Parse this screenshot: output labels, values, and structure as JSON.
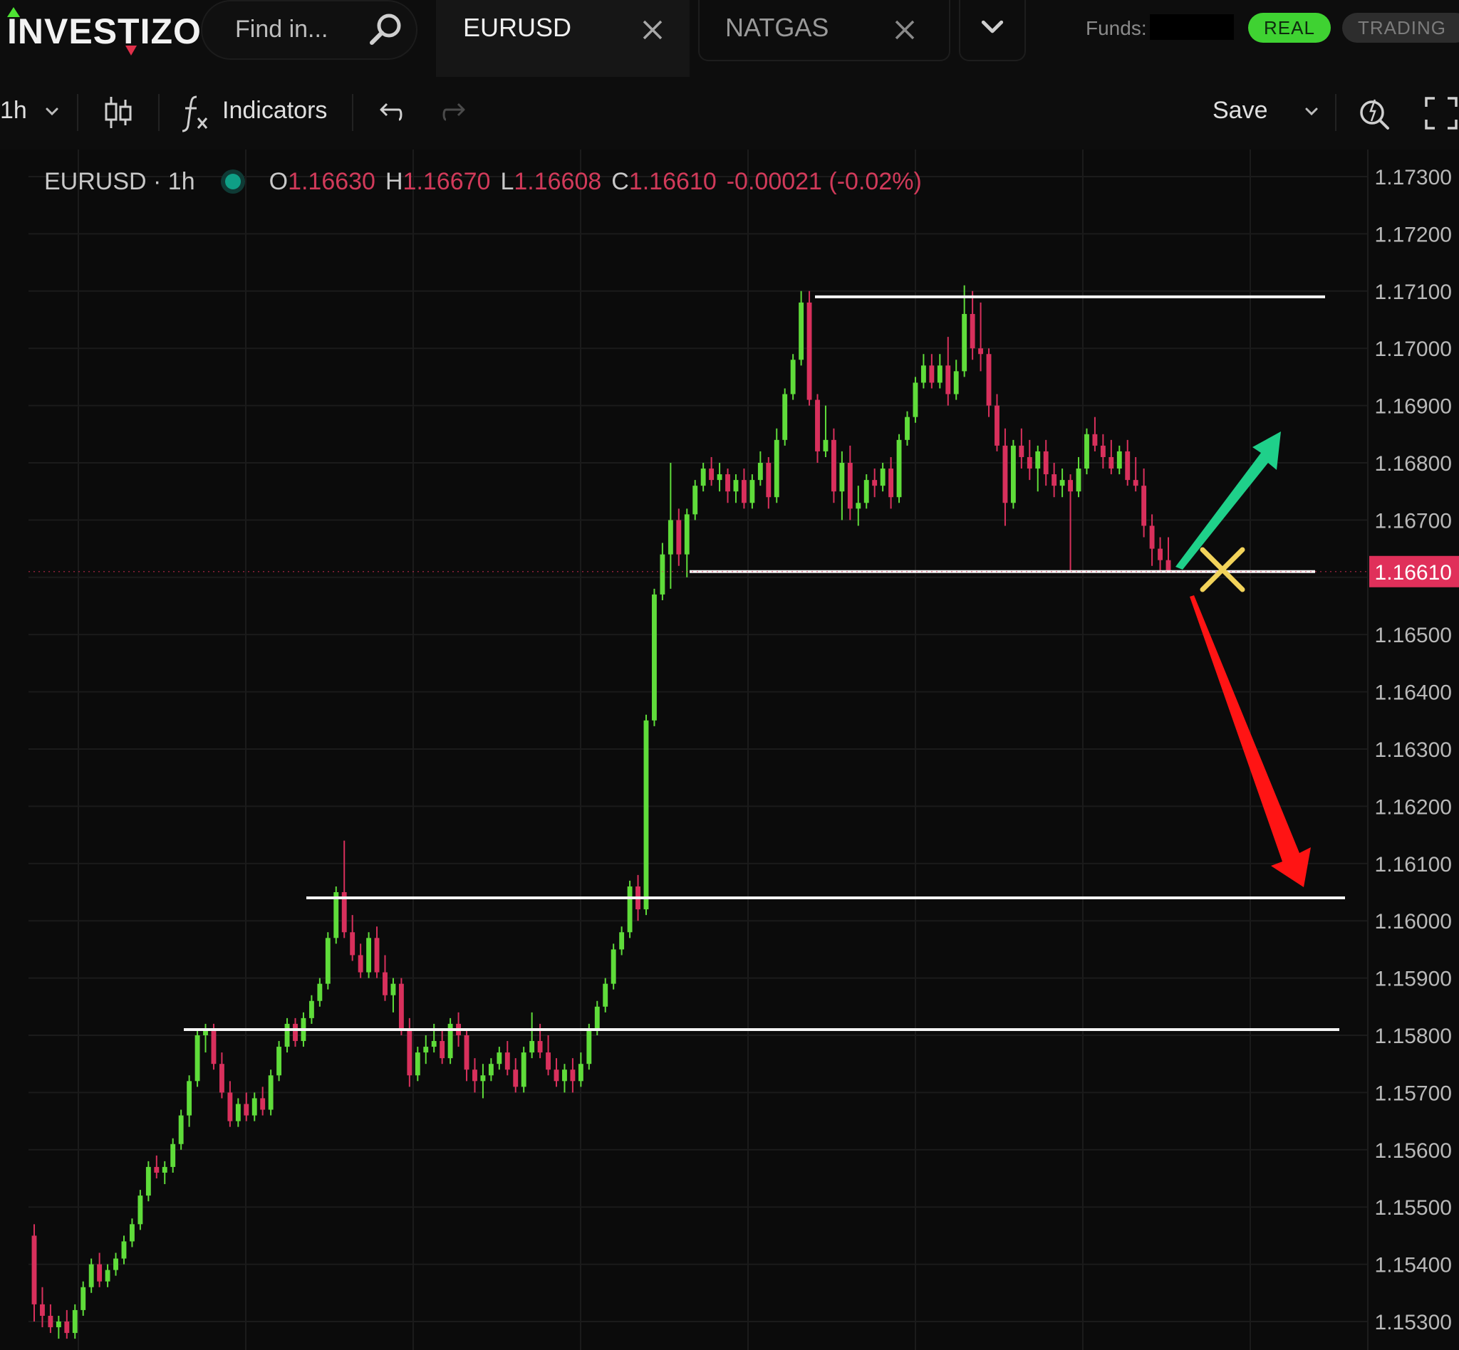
{
  "brand": {
    "logo_text": "INVESTIZO"
  },
  "search": {
    "placeholder": "Find in..."
  },
  "tabs": [
    {
      "label": "EURUSD",
      "active": true
    },
    {
      "label": "NATGAS",
      "active": false
    }
  ],
  "account": {
    "funds_label": "Funds:",
    "mode_real": "REAL",
    "mode_trading": "TRADING"
  },
  "toolbar": {
    "interval": "1h",
    "indicators_label": "Indicators",
    "save_label": "Save"
  },
  "legend": {
    "symbol": "EURUSD · 1h",
    "open_key": "O",
    "open": "1.16630",
    "high_key": "H",
    "high": "1.16670",
    "low_key": "L",
    "low": "1.16608",
    "close_key": "C",
    "close": "1.16610",
    "change": "-0.00021 (-0.02%)"
  },
  "colors": {
    "up": "#5fdc3a",
    "down": "#d8305c",
    "price_tag": "#e0305a",
    "accent_real": "#3fd232",
    "arrow_up": "#1fd08a",
    "arrow_down": "#ff1414",
    "cross_mark": "#f2d35a"
  },
  "chart_data": {
    "type": "candlestick",
    "ylim": [
      1.1527,
      1.1735
    ],
    "y_ticks": [
      "1.17300",
      "1.17200",
      "1.17100",
      "1.17000",
      "1.16900",
      "1.16800",
      "1.16700",
      "1.16500",
      "1.16400",
      "1.16300",
      "1.16200",
      "1.16100",
      "1.16000",
      "1.15900",
      "1.15800",
      "1.15700",
      "1.15600",
      "1.15500",
      "1.15400",
      "1.15300"
    ],
    "last_price": "1.16610",
    "horizontal_levels": [
      1.1709,
      1.1661,
      1.1604,
      1.1581
    ],
    "candles_approx": [
      [
        1.1545,
        1.1547,
        1.153,
        1.1533
      ],
      [
        1.1533,
        1.1536,
        1.1529,
        1.1531
      ],
      [
        1.1531,
        1.1533,
        1.1528,
        1.1529
      ],
      [
        1.1529,
        1.1531,
        1.1527,
        1.153
      ],
      [
        1.153,
        1.1532,
        1.1527,
        1.1528
      ],
      [
        1.1528,
        1.1533,
        1.1527,
        1.1532
      ],
      [
        1.1532,
        1.1537,
        1.1531,
        1.1536
      ],
      [
        1.1536,
        1.1541,
        1.1535,
        1.154
      ],
      [
        1.154,
        1.1542,
        1.1536,
        1.1537
      ],
      [
        1.1537,
        1.154,
        1.1536,
        1.1539
      ],
      [
        1.1539,
        1.1542,
        1.1538,
        1.1541
      ],
      [
        1.1541,
        1.1545,
        1.154,
        1.1544
      ],
      [
        1.1544,
        1.1548,
        1.1543,
        1.1547
      ],
      [
        1.1547,
        1.1553,
        1.1546,
        1.1552
      ],
      [
        1.1552,
        1.1558,
        1.1551,
        1.1557
      ],
      [
        1.1557,
        1.1559,
        1.1555,
        1.1556
      ],
      [
        1.1556,
        1.1558,
        1.1554,
        1.1557
      ],
      [
        1.1557,
        1.1562,
        1.1556,
        1.1561
      ],
      [
        1.1561,
        1.1567,
        1.156,
        1.1566
      ],
      [
        1.1566,
        1.1573,
        1.1564,
        1.1572
      ],
      [
        1.1572,
        1.1581,
        1.1571,
        1.158
      ],
      [
        1.158,
        1.1582,
        1.1577,
        1.1581
      ],
      [
        1.1581,
        1.1582,
        1.1574,
        1.1575
      ],
      [
        1.1575,
        1.1577,
        1.1569,
        1.157
      ],
      [
        1.157,
        1.1572,
        1.1564,
        1.1565
      ],
      [
        1.1565,
        1.1569,
        1.1564,
        1.1568
      ],
      [
        1.1568,
        1.157,
        1.1565,
        1.1566
      ],
      [
        1.1566,
        1.157,
        1.1565,
        1.1569
      ],
      [
        1.1569,
        1.1571,
        1.1566,
        1.1567
      ],
      [
        1.1567,
        1.1574,
        1.1566,
        1.1573
      ],
      [
        1.1573,
        1.1579,
        1.1572,
        1.1578
      ],
      [
        1.1578,
        1.1583,
        1.1577,
        1.1582
      ],
      [
        1.1582,
        1.1583,
        1.1578,
        1.1579
      ],
      [
        1.1579,
        1.1584,
        1.1578,
        1.1583
      ],
      [
        1.1583,
        1.1587,
        1.1582,
        1.1586
      ],
      [
        1.1586,
        1.159,
        1.1585,
        1.1589
      ],
      [
        1.1589,
        1.1598,
        1.1588,
        1.1597
      ],
      [
        1.1597,
        1.1606,
        1.1596,
        1.1605
      ],
      [
        1.1605,
        1.1614,
        1.1597,
        1.1598
      ],
      [
        1.1598,
        1.1601,
        1.1593,
        1.1594
      ],
      [
        1.1594,
        1.1596,
        1.159,
        1.1591
      ],
      [
        1.1591,
        1.1598,
        1.159,
        1.1597
      ],
      [
        1.1597,
        1.1599,
        1.159,
        1.1591
      ],
      [
        1.1591,
        1.1594,
        1.1586,
        1.1587
      ],
      [
        1.1587,
        1.159,
        1.1584,
        1.1589
      ],
      [
        1.1589,
        1.159,
        1.158,
        1.1581
      ],
      [
        1.1581,
        1.1583,
        1.1571,
        1.1573
      ],
      [
        1.1573,
        1.1578,
        1.1572,
        1.1577
      ],
      [
        1.1577,
        1.158,
        1.1575,
        1.1578
      ],
      [
        1.1578,
        1.1582,
        1.1577,
        1.1579
      ],
      [
        1.1579,
        1.1581,
        1.1575,
        1.1576
      ],
      [
        1.1576,
        1.1583,
        1.1575,
        1.1582
      ],
      [
        1.1582,
        1.1584,
        1.1578,
        1.158
      ],
      [
        1.158,
        1.1581,
        1.1572,
        1.1574
      ],
      [
        1.1574,
        1.1576,
        1.157,
        1.1572
      ],
      [
        1.1572,
        1.1575,
        1.1569,
        1.1573
      ],
      [
        1.1573,
        1.1576,
        1.1572,
        1.1575
      ],
      [
        1.1575,
        1.1578,
        1.1574,
        1.1577
      ],
      [
        1.1577,
        1.1579,
        1.1573,
        1.1574
      ],
      [
        1.1574,
        1.1576,
        1.157,
        1.1571
      ],
      [
        1.1571,
        1.1578,
        1.157,
        1.1577
      ],
      [
        1.1577,
        1.1584,
        1.1576,
        1.1579
      ],
      [
        1.1579,
        1.1582,
        1.1576,
        1.1577
      ],
      [
        1.1577,
        1.158,
        1.1573,
        1.1574
      ],
      [
        1.1574,
        1.1576,
        1.1571,
        1.1572
      ],
      [
        1.1572,
        1.1575,
        1.157,
        1.1574
      ],
      [
        1.1574,
        1.1576,
        1.157,
        1.1572
      ],
      [
        1.1572,
        1.1577,
        1.1571,
        1.1575
      ],
      [
        1.1575,
        1.1582,
        1.1574,
        1.1581
      ],
      [
        1.1581,
        1.1586,
        1.158,
        1.1585
      ],
      [
        1.1585,
        1.159,
        1.1584,
        1.1589
      ],
      [
        1.1589,
        1.1596,
        1.1588,
        1.1595
      ],
      [
        1.1595,
        1.1599,
        1.1594,
        1.1598
      ],
      [
        1.1598,
        1.1607,
        1.1597,
        1.1606
      ],
      [
        1.1606,
        1.1608,
        1.16,
        1.1602
      ],
      [
        1.1602,
        1.1636,
        1.1601,
        1.1635
      ],
      [
        1.1635,
        1.1658,
        1.1634,
        1.1657
      ],
      [
        1.1657,
        1.1666,
        1.1656,
        1.1664
      ],
      [
        1.1664,
        1.168,
        1.1658,
        1.167
      ],
      [
        1.167,
        1.1672,
        1.1662,
        1.1664
      ],
      [
        1.1664,
        1.1672,
        1.166,
        1.1671
      ],
      [
        1.1671,
        1.1677,
        1.167,
        1.1676
      ],
      [
        1.1676,
        1.168,
        1.1675,
        1.1679
      ],
      [
        1.1679,
        1.1681,
        1.1676,
        1.1677
      ],
      [
        1.1677,
        1.168,
        1.1675,
        1.1678
      ],
      [
        1.1678,
        1.1679,
        1.1673,
        1.1675
      ],
      [
        1.1675,
        1.1678,
        1.1673,
        1.1677
      ],
      [
        1.1677,
        1.1679,
        1.1672,
        1.1673
      ],
      [
        1.1673,
        1.1678,
        1.1672,
        1.1677
      ],
      [
        1.1677,
        1.1682,
        1.1676,
        1.168
      ],
      [
        1.168,
        1.1681,
        1.1672,
        1.1674
      ],
      [
        1.1674,
        1.1686,
        1.1673,
        1.1684
      ],
      [
        1.1684,
        1.1693,
        1.1683,
        1.1692
      ],
      [
        1.1692,
        1.1699,
        1.1691,
        1.1698
      ],
      [
        1.1698,
        1.171,
        1.1697,
        1.1708
      ],
      [
        1.1708,
        1.171,
        1.169,
        1.1691
      ],
      [
        1.1691,
        1.1692,
        1.168,
        1.1682
      ],
      [
        1.1682,
        1.169,
        1.1681,
        1.1684
      ],
      [
        1.1684,
        1.1686,
        1.1673,
        1.1675
      ],
      [
        1.1675,
        1.1682,
        1.167,
        1.168
      ],
      [
        1.168,
        1.1683,
        1.167,
        1.1672
      ],
      [
        1.1672,
        1.1676,
        1.1669,
        1.1673
      ],
      [
        1.1673,
        1.1678,
        1.1672,
        1.1677
      ],
      [
        1.1677,
        1.1679,
        1.1674,
        1.1676
      ],
      [
        1.1676,
        1.168,
        1.1675,
        1.1679
      ],
      [
        1.1679,
        1.1681,
        1.1672,
        1.1674
      ],
      [
        1.1674,
        1.1685,
        1.1673,
        1.1684
      ],
      [
        1.1684,
        1.1689,
        1.1683,
        1.1688
      ],
      [
        1.1688,
        1.1695,
        1.1687,
        1.1694
      ],
      [
        1.1694,
        1.1699,
        1.1693,
        1.1697
      ],
      [
        1.1697,
        1.1699,
        1.1693,
        1.1694
      ],
      [
        1.1694,
        1.1699,
        1.1693,
        1.1697
      ],
      [
        1.1697,
        1.1702,
        1.169,
        1.1692
      ],
      [
        1.1692,
        1.1698,
        1.1691,
        1.1696
      ],
      [
        1.1696,
        1.1711,
        1.1695,
        1.1706
      ],
      [
        1.1706,
        1.171,
        1.1698,
        1.17
      ],
      [
        1.17,
        1.1708,
        1.1696,
        1.1699
      ],
      [
        1.1699,
        1.17,
        1.1688,
        1.169
      ],
      [
        1.169,
        1.1692,
        1.1682,
        1.1683
      ],
      [
        1.1683,
        1.1686,
        1.1669,
        1.1673
      ],
      [
        1.1673,
        1.1684,
        1.1672,
        1.1683
      ],
      [
        1.1683,
        1.1686,
        1.1679,
        1.1681
      ],
      [
        1.1681,
        1.1684,
        1.1677,
        1.1679
      ],
      [
        1.1679,
        1.1683,
        1.1675,
        1.1682
      ],
      [
        1.1682,
        1.1684,
        1.1676,
        1.1678
      ],
      [
        1.1678,
        1.168,
        1.1674,
        1.1676
      ],
      [
        1.1676,
        1.1679,
        1.1674,
        1.1677
      ],
      [
        1.1677,
        1.1678,
        1.1661,
        1.1675
      ],
      [
        1.1675,
        1.1681,
        1.1674,
        1.1679
      ],
      [
        1.1679,
        1.1686,
        1.1678,
        1.1685
      ],
      [
        1.1685,
        1.1688,
        1.1682,
        1.1683
      ],
      [
        1.1683,
        1.1685,
        1.1679,
        1.1681
      ],
      [
        1.1681,
        1.1684,
        1.1678,
        1.1679
      ],
      [
        1.1679,
        1.1683,
        1.1678,
        1.1682
      ],
      [
        1.1682,
        1.1684,
        1.1676,
        1.1677
      ],
      [
        1.1677,
        1.1681,
        1.1675,
        1.1676
      ],
      [
        1.1676,
        1.1679,
        1.1667,
        1.1669
      ],
      [
        1.1669,
        1.1671,
        1.1662,
        1.1665
      ],
      [
        1.1665,
        1.1667,
        1.1661,
        1.1663
      ],
      [
        1.1663,
        1.1667,
        1.1661,
        1.1661
      ]
    ]
  }
}
